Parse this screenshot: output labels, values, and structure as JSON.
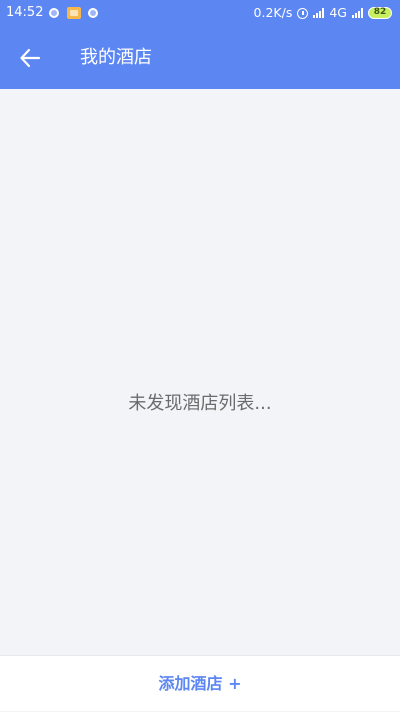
{
  "status_bar": {
    "time": "14:52",
    "network_speed": "0.2K/s",
    "network_type": "4G",
    "battery": "82"
  },
  "header": {
    "title": "我的酒店",
    "back_icon": "arrow-left-icon"
  },
  "content": {
    "empty_message": "未发现酒店列表..."
  },
  "footer": {
    "add_hotel_label": "添加酒店 +"
  },
  "colors": {
    "primary": "#5c86f2",
    "background": "#f3f4f7",
    "empty_text": "#6b6b6b"
  }
}
